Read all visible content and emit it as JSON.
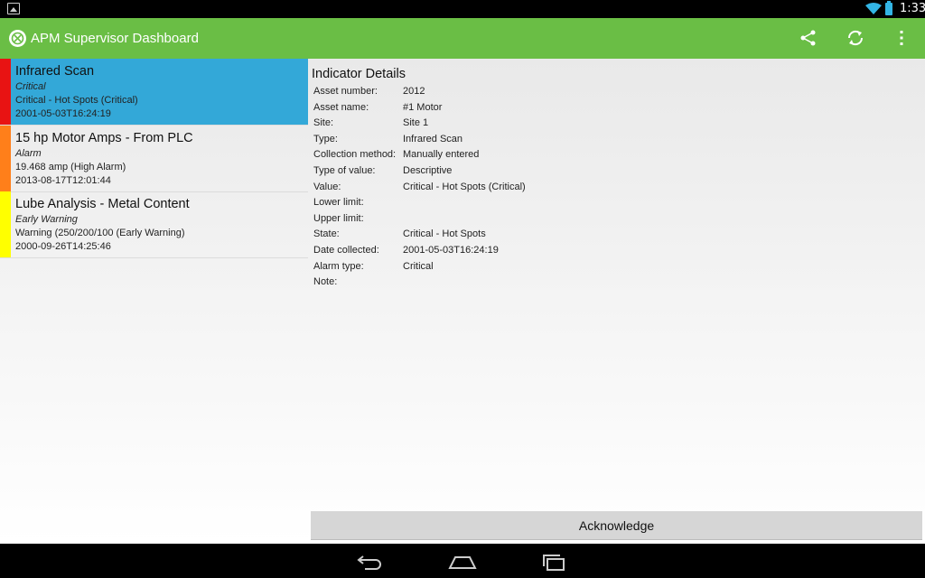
{
  "status_bar": {
    "time": "1:33",
    "icons": [
      "gallery-notification-icon",
      "wifi-icon",
      "battery-icon"
    ]
  },
  "action_bar": {
    "title": "APM Supervisor Dashboard",
    "icons": [
      "app-logo-icon",
      "share-icon",
      "refresh-icon",
      "overflow-menu-icon"
    ],
    "color": "#6abe45"
  },
  "indicators": [
    {
      "title": "Infrared Scan",
      "level": "Critical",
      "value": "Critical - Hot Spots (Critical)",
      "date": "2001-05-03T16:24:19",
      "color": "#e81313",
      "selected": true
    },
    {
      "title": "15 hp Motor Amps - From PLC",
      "level": "Alarm",
      "value": "19.468 amp (High Alarm)",
      "date": "2013-08-17T12:01:44",
      "color": "#ff7f1a",
      "selected": false
    },
    {
      "title": "Lube Analysis - Metal Content",
      "level": "Early Warning",
      "value": "Warning (250/200/100 (Early Warning)",
      "date": "2000-09-26T14:25:46",
      "color": "#ffff00",
      "selected": false
    }
  ],
  "details": {
    "title": "Indicator Details",
    "rows": [
      {
        "label": "Asset number:",
        "value": "2012"
      },
      {
        "label": "Asset name:",
        "value": "#1 Motor"
      },
      {
        "label": "Site:",
        "value": "Site 1"
      },
      {
        "label": "Type:",
        "value": "Infrared Scan"
      },
      {
        "label": "Collection method:",
        "value": "Manually entered"
      },
      {
        "label": "Type of value:",
        "value": "Descriptive"
      },
      {
        "label": "Value:",
        "value": "Critical - Hot Spots (Critical)"
      },
      {
        "label": "Lower limit:",
        "value": ""
      },
      {
        "label": "Upper limit:",
        "value": ""
      },
      {
        "label": "State:",
        "value": "Critical - Hot Spots"
      },
      {
        "label": "Date collected:",
        "value": "2001-05-03T16:24:19"
      },
      {
        "label": "Alarm type:",
        "value": "Critical"
      },
      {
        "label": "Note:",
        "value": ""
      }
    ],
    "acknowledge_label": "Acknowledge"
  },
  "nav_bar": {
    "icons": [
      "back-icon",
      "home-icon",
      "recent-apps-icon"
    ]
  },
  "selected_color": "#33a8d8"
}
